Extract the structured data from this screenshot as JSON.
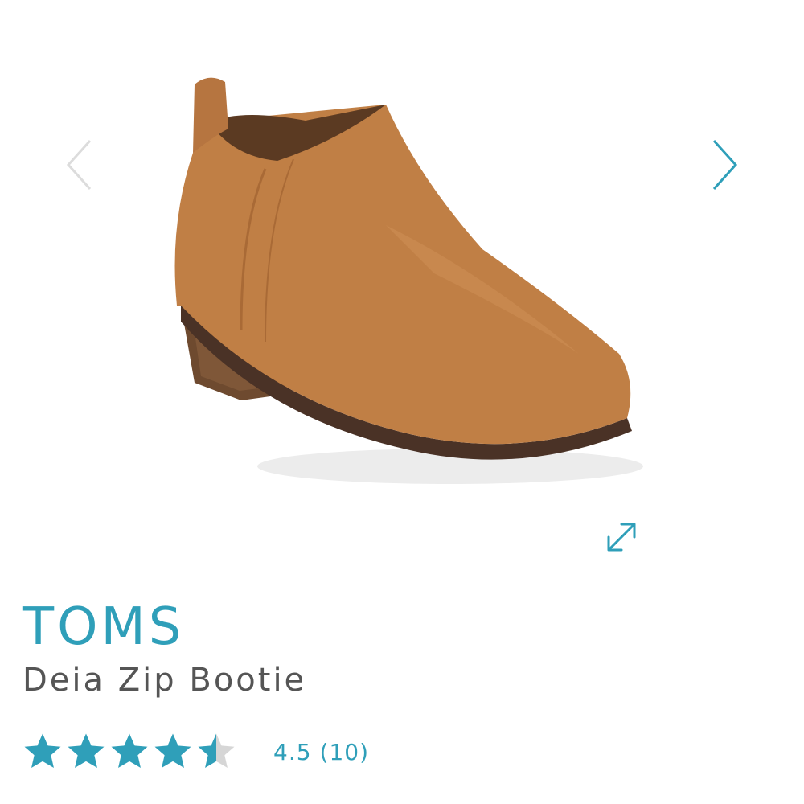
{
  "brand": "TOMS",
  "product_name": "Deia Zip Bootie",
  "rating": {
    "value": "4.5",
    "count": "(10)",
    "stars_filled_fraction": 0.9
  },
  "gallery": {
    "prev_icon": "chevron-left-icon",
    "next_icon": "chevron-right-icon",
    "expand_icon": "expand-arrows-icon"
  },
  "colors": {
    "accent": "#2f9fb9",
    "text": "#555555",
    "star_empty": "#d6d6d6"
  }
}
